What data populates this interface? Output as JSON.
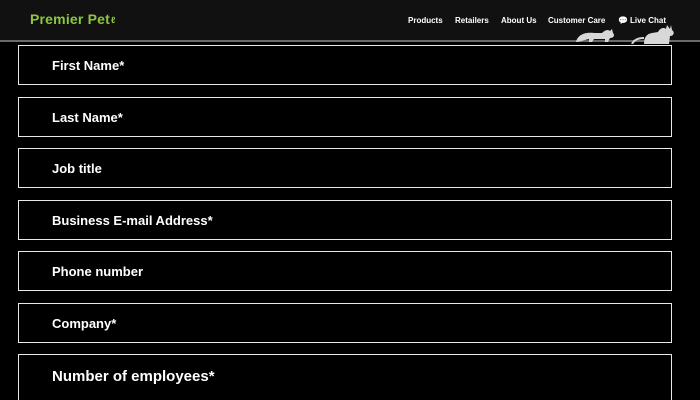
{
  "header": {
    "logo_text": "Premier Pet",
    "nav": {
      "products": "Products",
      "retailers": "Retailers",
      "about_us": "About Us",
      "customer_care": "Customer Care",
      "live_chat": "Live Chat"
    }
  },
  "form": {
    "fields": [
      {
        "label": "First Name*"
      },
      {
        "label": "Last Name*"
      },
      {
        "label": "Job title"
      },
      {
        "label": "Business E-mail Address*"
      },
      {
        "label": "Phone number"
      },
      {
        "label": "Company*"
      },
      {
        "label": "Number of employees*"
      }
    ]
  },
  "colors": {
    "brand_green": "#8dc63f",
    "background": "#000000",
    "border": "#e9e9e9"
  }
}
